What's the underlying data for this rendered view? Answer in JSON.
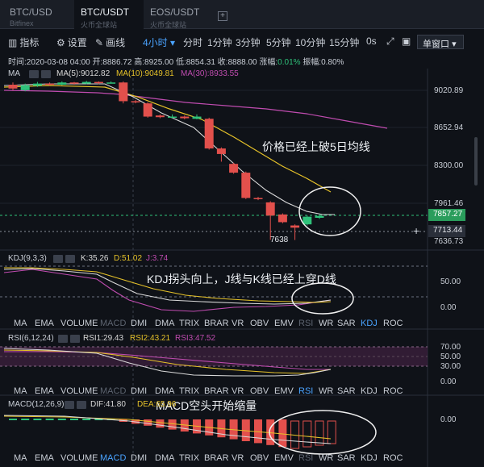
{
  "tabs": [
    {
      "label": "BTC/USD",
      "sub": "Bitfinex"
    },
    {
      "label": "BTC/USDT",
      "sub": "火币全球站"
    },
    {
      "label": "EOS/USDT",
      "sub": "火币全球站"
    }
  ],
  "tab_add": "+",
  "toolbar": {
    "indicator": "指标",
    "settings": "设置",
    "draw": "画线",
    "interval_selected": "4小时",
    "intervals": [
      "分时",
      "1分钟",
      "3分钟",
      "5分钟",
      "10分钟",
      "15分钟",
      "0s"
    ],
    "window_mode": "单窗口"
  },
  "info": {
    "time": "时间:2020-03-08 04:00",
    "open": "开:8886.72",
    "high": "高:8925.00",
    "low": "低:8854.31",
    "close": "收:8888.00",
    "change_label": "涨幅:",
    "change_value": "0.01%",
    "amp": "振幅:0.80%"
  },
  "ma": {
    "label": "MA",
    "ma5": "MA(5):9012.82",
    "ma10": "MA(10):9049.81",
    "ma30": "MA(30):8933.55"
  },
  "price_axis": [
    "9020.89",
    "8652.94",
    "8300.00",
    "7961.46",
    "7636.73"
  ],
  "current_price": "7857.27",
  "cross_price": "7713.44",
  "low_marker": "7638",
  "annotations": {
    "main": "价格已经上破5日均线",
    "kdj": "KDJ拐头向上，J线与K线已经上穿D线",
    "macd": "MACD空头开始缩量"
  },
  "kdj": {
    "label": "KDJ(9,3,3)",
    "k": "K:35.26",
    "d": "D:51.02",
    "j": "J:3.74",
    "axis": [
      "50.00",
      "0.00"
    ]
  },
  "rsi": {
    "label": "RSI(6,12,24)",
    "rsi1": "RSI1:29.43",
    "rsi2": "RSI2:43.21",
    "rsi3": "RSI3:47.52",
    "axis": [
      "70.00",
      "50.00",
      "30.00",
      "0.00"
    ]
  },
  "macd": {
    "label": "MACD(12,26,9)",
    "dif": "DIF:41.80",
    "dea": "DEA:65.96",
    "axis": [
      "0.00"
    ]
  },
  "indicator_tabs": [
    "MA",
    "EMA",
    "VOLUME",
    "MACD",
    "DMI",
    "DMA",
    "TRIX",
    "BRAR",
    "VR",
    "OBV",
    "EMV",
    "RSI",
    "WR",
    "SAR",
    "KDJ",
    "ROC"
  ],
  "colors": {
    "up": "#2fc27a",
    "down": "#e2504c",
    "ma5": "#d9d9d9",
    "ma10": "#e6c229",
    "ma30": "#c04cb0",
    "accent": "#4aa3ff"
  },
  "chart_data": {
    "type": "candlestick",
    "candles": [
      {
        "o": 9050,
        "c": 9015,
        "h": 9070,
        "l": 9000
      },
      {
        "o": 9000,
        "c": 9045,
        "h": 9060,
        "l": 8990
      },
      {
        "o": 9040,
        "c": 9060,
        "h": 9075,
        "l": 9030
      },
      {
        "o": 9060,
        "c": 9050,
        "h": 9070,
        "l": 9040
      },
      {
        "o": 9050,
        "c": 9070,
        "h": 9080,
        "l": 9045
      },
      {
        "o": 9070,
        "c": 9060,
        "h": 9075,
        "l": 9050
      },
      {
        "o": 9060,
        "c": 9075,
        "h": 9085,
        "l": 9055
      },
      {
        "o": 9075,
        "c": 9065,
        "h": 9080,
        "l": 9055
      },
      {
        "o": 9065,
        "c": 9070,
        "h": 9080,
        "l": 9060
      },
      {
        "o": 9070,
        "c": 8900,
        "h": 9080,
        "l": 8880
      },
      {
        "o": 8900,
        "c": 8895,
        "h": 8910,
        "l": 8880
      },
      {
        "o": 8880,
        "c": 8760,
        "h": 8890,
        "l": 8750
      },
      {
        "o": 8770,
        "c": 8755,
        "h": 8780,
        "l": 8745
      },
      {
        "o": 8750,
        "c": 8760,
        "h": 8780,
        "l": 8745
      },
      {
        "o": 8760,
        "c": 8745,
        "h": 8770,
        "l": 8735
      },
      {
        "o": 8740,
        "c": 8760,
        "h": 8780,
        "l": 8735
      },
      {
        "o": 8740,
        "c": 8470,
        "h": 8750,
        "l": 8460
      },
      {
        "o": 8470,
        "c": 8420,
        "h": 8480,
        "l": 8350
      },
      {
        "o": 8330,
        "c": 8250,
        "h": 8340,
        "l": 8240
      },
      {
        "o": 8250,
        "c": 8020,
        "h": 8260,
        "l": 8010
      },
      {
        "o": 8020,
        "c": 8010,
        "h": 8030,
        "l": 8000
      },
      {
        "o": 7980,
        "c": 7860,
        "h": 7990,
        "l": 7640
      },
      {
        "o": 7870,
        "c": 7800,
        "h": 7880,
        "l": 7790
      },
      {
        "o": 7770,
        "c": 7750,
        "h": 7780,
        "l": 7638
      },
      {
        "o": 7780,
        "c": 7850,
        "h": 7860,
        "l": 7770
      },
      {
        "o": 7840,
        "c": 7857,
        "h": 7870,
        "l": 7830
      }
    ],
    "ylim": [
      7620,
      9160
    ]
  }
}
